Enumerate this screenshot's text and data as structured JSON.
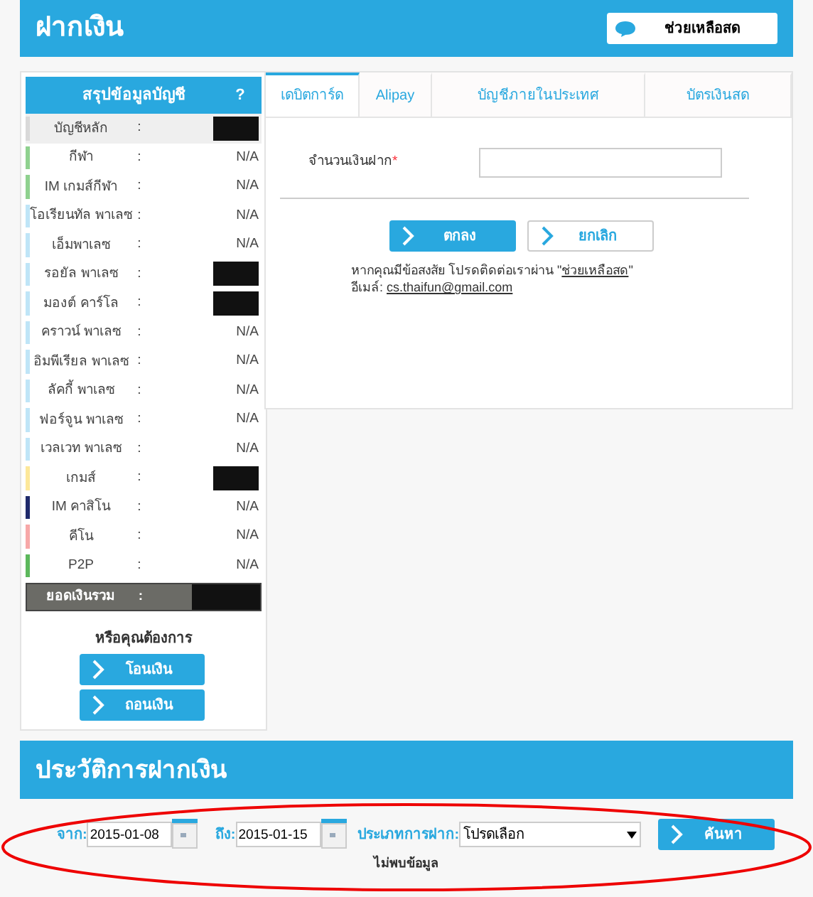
{
  "header": {
    "title": "ฝากเงิน",
    "help_button": "ช่วยเหลือสด"
  },
  "summary": {
    "title": "สรุปข้อมูลบัญชี",
    "help": "?",
    "rows": [
      {
        "label": "บัญชีหลัก",
        "colon": ":",
        "kind": "masked",
        "color": "#d9d9d9",
        "highlight": true
      },
      {
        "label": "กีฬา",
        "colon": ":",
        "kind": "value",
        "value": "N/A",
        "color": "#8fd18f"
      },
      {
        "label": "IM เกมส์กีฬา",
        "colon": ":",
        "kind": "value",
        "value": "N/A",
        "color": "#8fd18f"
      },
      {
        "label": "โอเรียนทัล พาเลซ",
        "colon": ":",
        "kind": "value",
        "value": "N/A",
        "color": "#bfe5f7"
      },
      {
        "label": "เอ็มพาเลซ",
        "colon": ":",
        "kind": "value",
        "value": "N/A",
        "color": "#bfe5f7"
      },
      {
        "label": "รอยัล พาเลซ",
        "colon": ":",
        "kind": "masked",
        "color": "#bfe5f7"
      },
      {
        "label": "มองต์ คาร์โล",
        "colon": ":",
        "kind": "masked",
        "color": "#bfe5f7"
      },
      {
        "label": "คราวน์ พาเลซ",
        "colon": ":",
        "kind": "value",
        "value": "N/A",
        "color": "#bfe5f7"
      },
      {
        "label": "อิมพีเรียล พาเลซ",
        "colon": ":",
        "kind": "value",
        "value": "N/A",
        "color": "#bfe5f7"
      },
      {
        "label": "ลัคกี้ พาเลซ",
        "colon": ":",
        "kind": "value",
        "value": "N/A",
        "color": "#bfe5f7"
      },
      {
        "label": "ฟอร์จูน พาเลซ",
        "colon": ":",
        "kind": "value",
        "value": "N/A",
        "color": "#bfe5f7"
      },
      {
        "label": "เวลเวท พาเลซ",
        "colon": ":",
        "kind": "value",
        "value": "N/A",
        "color": "#bfe5f7"
      },
      {
        "label": "เกมส์",
        "colon": ":",
        "kind": "masked",
        "color": "#fde89a"
      },
      {
        "label": "IM คาสิโน",
        "colon": ":",
        "kind": "value",
        "value": "N/A",
        "color": "#1f2a6b"
      },
      {
        "label": "คีโน",
        "colon": ":",
        "kind": "value",
        "value": "N/A",
        "color": "#f7a8a8"
      },
      {
        "label": "P2P",
        "colon": ":",
        "kind": "value",
        "value": "N/A",
        "color": "#5cb85c"
      }
    ],
    "total": {
      "label": "ยอดเงินรวม",
      "colon": ":"
    },
    "prompt": "หรือคุณต้องการ",
    "actions": [
      "โอนเงิน",
      "ถอนเงิน"
    ]
  },
  "tabs": [
    {
      "label": "เดบิตการ์ด",
      "selected": true
    },
    {
      "label": "Alipay",
      "selected": false
    },
    {
      "label": "บัญชีภายในประเทศ",
      "selected": false
    },
    {
      "label": "บัตรเงินสด",
      "selected": false
    }
  ],
  "form": {
    "amount_label": "จำนวนเงินฝาก",
    "required_mark": "*",
    "submit": "ตกลง",
    "cancel": "ยกเลิก",
    "help_text": "หากคุณมีข้อสงสัย โปรดติดต่อเราผ่าน \"",
    "help_link": "ช่วยเหลือสด",
    "help_end": "\"",
    "email_label": "อีเมล์: ",
    "email": "cs.thaifun@gmail.com"
  },
  "history": {
    "title": "ประวัติการฝากเงิน",
    "from_label": "จาก:",
    "from_value": "2015-01-08",
    "to_label": "ถึง:",
    "to_value": "2015-01-15",
    "type_label": "ประเภทการฝาก:",
    "type_value": "โปรดเลือก",
    "search": "ค้นหา",
    "empty": "ไม่พบข้อมูล"
  }
}
